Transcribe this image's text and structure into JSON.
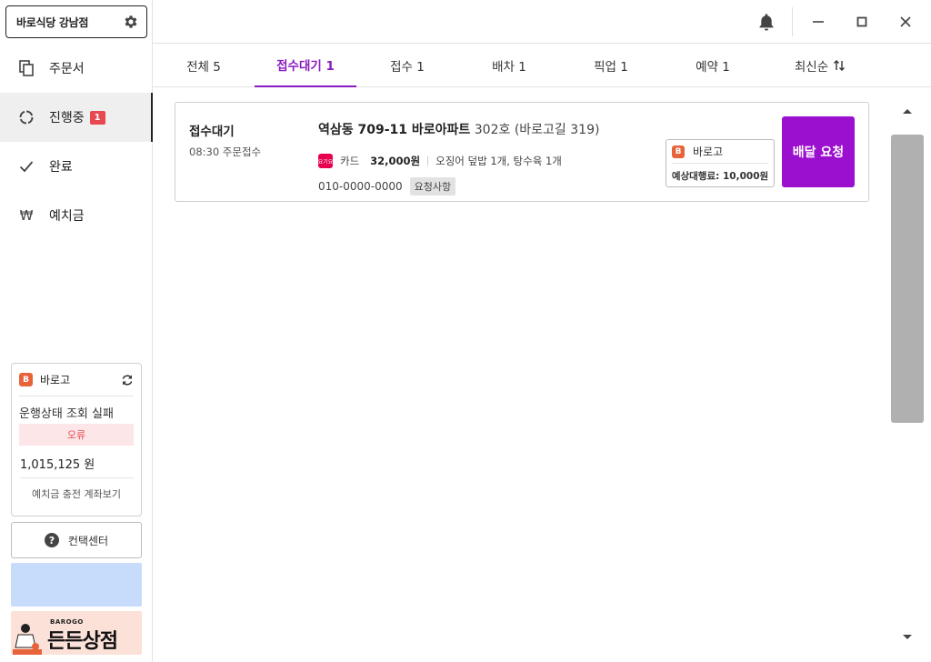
{
  "sidebar": {
    "store_name": "바로식당 강남점",
    "nav": [
      {
        "label": "주문서",
        "icon": "copy-icon"
      },
      {
        "label": "진행중",
        "icon": "progress-icon",
        "badge": "1"
      },
      {
        "label": "완료",
        "icon": "check-icon"
      },
      {
        "label": "예치금",
        "icon": "won-icon",
        "symbol": "₩"
      }
    ],
    "deposit": {
      "brand": "바로고",
      "status": "운행상태 조회 실패",
      "error": "오류",
      "amount": "1,015,125 원",
      "link": "예치금 충전 계좌보기"
    },
    "contact_label": "컨택센터",
    "banner": {
      "small_text": "BAROGO",
      "big_text": "든든상점"
    }
  },
  "tabs": [
    {
      "label": "전체 5",
      "active": false
    },
    {
      "label": "접수대기 1",
      "active": true
    },
    {
      "label": "접수 1",
      "active": false
    },
    {
      "label": "배차 1",
      "active": false
    },
    {
      "label": "픽업 1",
      "active": false
    },
    {
      "label": "예약 1",
      "active": false
    }
  ],
  "sort": {
    "label": "최신순",
    "icon": "sort-arrows-icon"
  },
  "order": {
    "status": "접수대기",
    "time": "08:30 주문접수",
    "address_main": "역삼동 709-11 바로아파트",
    "address_rest": "302호  (바로고길 319)",
    "payment_logo_text": "요기요",
    "payment_method": "카드",
    "amount": "32,000원",
    "items": "오징어 덮밥 1개, 탕수육 1개",
    "phone": "010-0000-0000",
    "request_tag": "요청사항",
    "agency_name": "바로고",
    "agency_fee": "예상대행료: 10,000원",
    "deliver_button": "배달 요청"
  },
  "colors": {
    "accent": "#8a1cbf",
    "deliver_button": "#9b0fcf",
    "badge": "#e8484f",
    "brand_orange": "#e8633a"
  }
}
